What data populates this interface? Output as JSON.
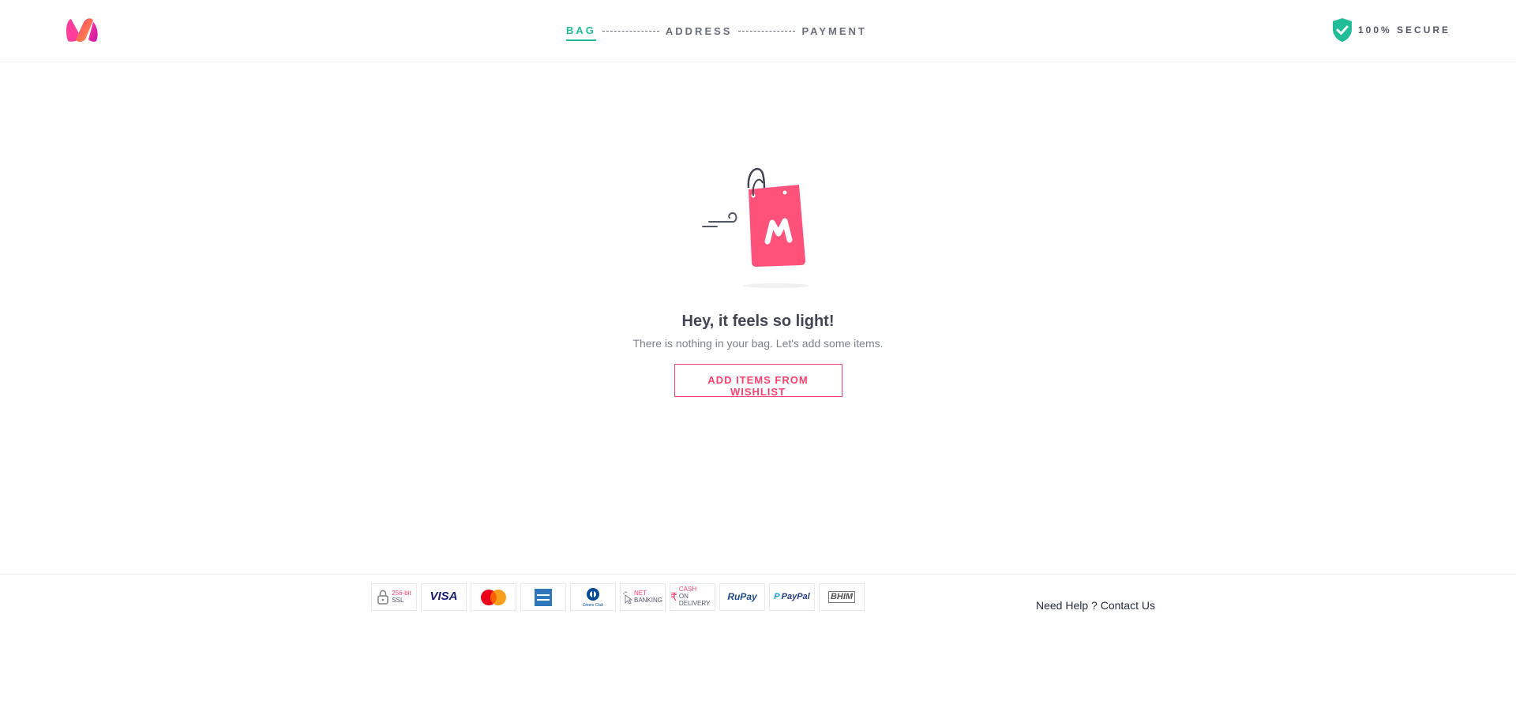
{
  "header": {
    "logo_icon": "myntra-logo-icon",
    "steps": [
      {
        "label": "BAG",
        "active": true
      },
      {
        "label": "ADDRESS",
        "active": false
      },
      {
        "label": "PAYMENT",
        "active": false
      }
    ],
    "secure_label": "100% SECURE",
    "secure_icon": "shield-check-icon"
  },
  "empty_bag": {
    "illustration": "empty-shopping-bag-icon",
    "title": "Hey, it feels so light!",
    "subtitle": "There is nothing in your bag. Let's add some items.",
    "button_label": "ADD ITEMS FROM WISHLIST"
  },
  "footer": {
    "payment_badges": [
      {
        "name": "ssl",
        "line1": "256-bit",
        "line2": "SSL"
      },
      {
        "name": "visa",
        "label": "VISA"
      },
      {
        "name": "mastercard",
        "label": "MasterCard"
      },
      {
        "name": "amex",
        "label": "AMERICAN EXPRESS"
      },
      {
        "name": "diners",
        "label": "Diners Club International"
      },
      {
        "name": "net-banking",
        "line1": "NET",
        "line2": "BANKING"
      },
      {
        "name": "cod",
        "line1": "CASH",
        "line2": "ON DELIVERY"
      },
      {
        "name": "rupay",
        "label": "RuPay"
      },
      {
        "name": "paypal",
        "label": "PayPal"
      },
      {
        "name": "bhim",
        "label": "BHIM"
      }
    ],
    "help_text": "Need Help ?",
    "contact_link": "Contact Us"
  },
  "colors": {
    "accent_green": "#20bd99",
    "brand_pink": "#ff3f6c"
  }
}
